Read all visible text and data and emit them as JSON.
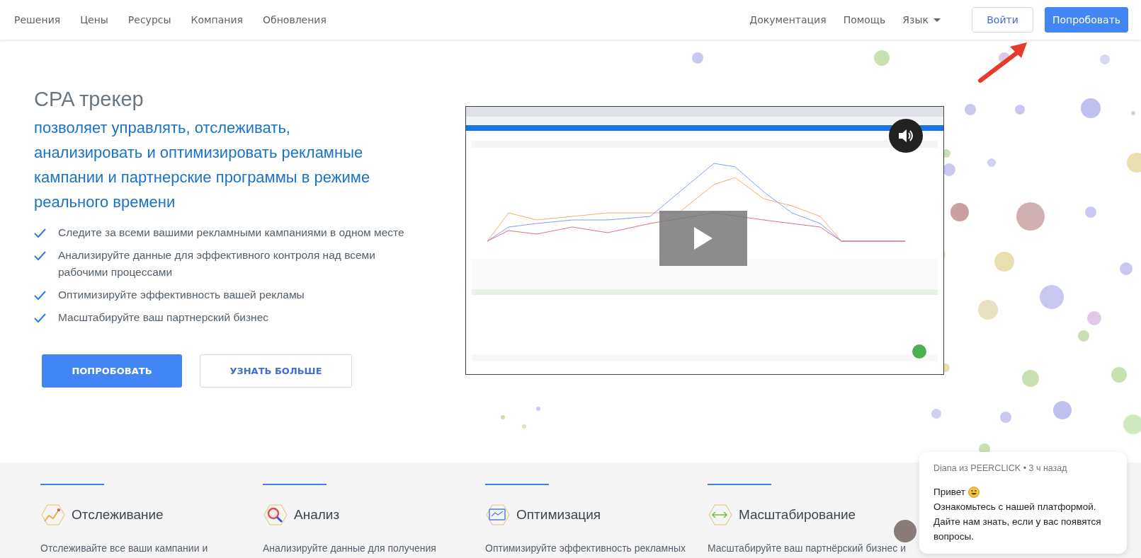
{
  "nav": {
    "left": [
      {
        "label": "Решения"
      },
      {
        "label": "Цены"
      },
      {
        "label": "Ресурсы"
      },
      {
        "label": "Компания"
      },
      {
        "label": "Обновления"
      }
    ],
    "right": [
      {
        "label": "Документация",
        "kind": "link"
      },
      {
        "label": "Помощь",
        "kind": "link"
      },
      {
        "label": "Язык",
        "kind": "dropdown"
      }
    ],
    "login": "Войти",
    "try": "Попробовать"
  },
  "hero": {
    "title": "CPA трекер",
    "subtitle": "позволяет управлять, отслеживать, анализировать и оптимизировать рекламные кампании и партнерские программы в режиме реального времени",
    "features": [
      "Следите за всеми вашими рекламными кампаниями в одном месте",
      "Анализируйте данные для эффективного контроля над всеми рабочими процессами",
      "Оптимизируйте эффективность вашей рекламы",
      "Масштабируйте ваш партнерский бизнес"
    ],
    "primary_button": "ПОПРОБОВАТЬ",
    "secondary_button": "УЗНАТЬ БОЛЬШЕ",
    "video": {
      "kind": "picture"
    }
  },
  "cards": [
    {
      "title": "Отслеживание",
      "text": "Отслеживайте все ваши кампании и"
    },
    {
      "title": "Анализ",
      "text": "Анализируйте данные для получения"
    },
    {
      "title": "Оптимизация",
      "text": "Оптимизируйте эффективность рекламных"
    },
    {
      "title": "Масштабирование",
      "text": "Масштабируйте ваш партнёрский бизнес и"
    }
  ],
  "chat": {
    "author": "Diana из PEERCLICK • 3 ч назад",
    "lines": [
      "Привет",
      "Ознакомьтесь с нашей платформой.",
      "Дайте нам знать, если у вас появятся",
      "вопросы."
    ]
  }
}
